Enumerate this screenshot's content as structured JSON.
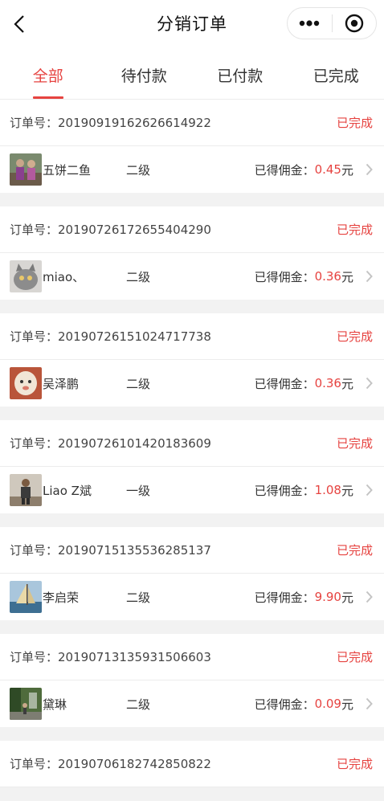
{
  "header": {
    "title": "分销订单"
  },
  "tabs": [
    {
      "label": "全部",
      "active": true
    },
    {
      "label": "待付款",
      "active": false
    },
    {
      "label": "已付款",
      "active": false
    },
    {
      "label": "已完成",
      "active": false
    }
  ],
  "labels": {
    "order_no_prefix": "订单号：",
    "commission_prefix": "已得佣金：",
    "currency_unit": "元"
  },
  "colors": {
    "accent": "#e64340",
    "background": "#f2f2f2"
  },
  "orders": [
    {
      "order_no": "2019091916262661492 2",
      "status": "已完成",
      "buyer": "五饼二鱼",
      "level": "二级",
      "amount": "0.45",
      "avatar_icon": "avatar-photo-people"
    },
    {
      "order_no": "20190726172655404290",
      "status": "已完成",
      "buyer": "miao、",
      "level": "二级",
      "amount": "0.36",
      "avatar_icon": "avatar-photo-cat"
    },
    {
      "order_no": "20190726151024717738",
      "status": "已完成",
      "buyer": "吴泽鹏",
      "level": "二级",
      "amount": "0.36",
      "avatar_icon": "avatar-photo-toy"
    },
    {
      "order_no": "20190726101420183609",
      "status": "已完成",
      "buyer": "Liao Z斌",
      "level": "一级",
      "amount": "1.08",
      "avatar_icon": "avatar-photo-person"
    },
    {
      "order_no": "20190715135536285137",
      "status": "已完成",
      "buyer": "李启荣",
      "level": "二级",
      "amount": "9.90",
      "avatar_icon": "avatar-photo-sailboat"
    },
    {
      "order_no": "20190713135931506603",
      "status": "已完成",
      "buyer": "黛琳",
      "level": "二级",
      "amount": "0.09",
      "avatar_icon": "avatar-photo-garden"
    },
    {
      "order_no": "20190706182742850822",
      "status": "已完成",
      "buyer": "",
      "level": "",
      "amount": "",
      "avatar_icon": ""
    }
  ]
}
